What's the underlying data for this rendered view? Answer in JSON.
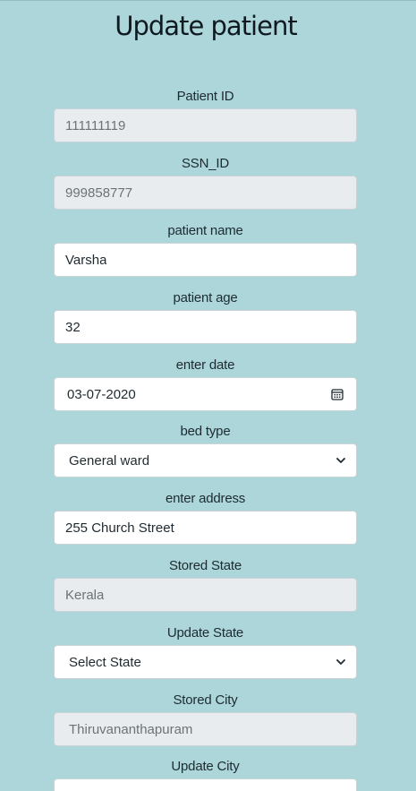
{
  "page": {
    "title": "Update patient"
  },
  "form": {
    "patient_id": {
      "label": "Patient ID",
      "value": "111111119"
    },
    "ssn_id": {
      "label": "SSN_ID",
      "value": "999858777"
    },
    "patient_name": {
      "label": "patient name",
      "value": "Varsha"
    },
    "patient_age": {
      "label": "patient age",
      "value": "32"
    },
    "enter_date": {
      "label": "enter date",
      "value": "03-07-2020",
      "icon": "calendar-icon"
    },
    "bed_type": {
      "label": "bed type",
      "value": "General ward",
      "icon": "chevron-down-icon"
    },
    "address": {
      "label": "enter address",
      "value": "255 Church Street"
    },
    "stored_state": {
      "label": "Stored State",
      "value": "Kerala"
    },
    "update_state": {
      "label": "Update State",
      "value": "Select State",
      "icon": "chevron-down-icon"
    },
    "stored_city": {
      "label": "Stored City",
      "value": "Thiruvananthapuram"
    },
    "update_city": {
      "label": "Update City",
      "value": ""
    }
  },
  "colors": {
    "background": "#acd6da",
    "input_bg": "#ffffff",
    "readonly_bg": "#e9ecef",
    "border": "#c9d3d8"
  }
}
